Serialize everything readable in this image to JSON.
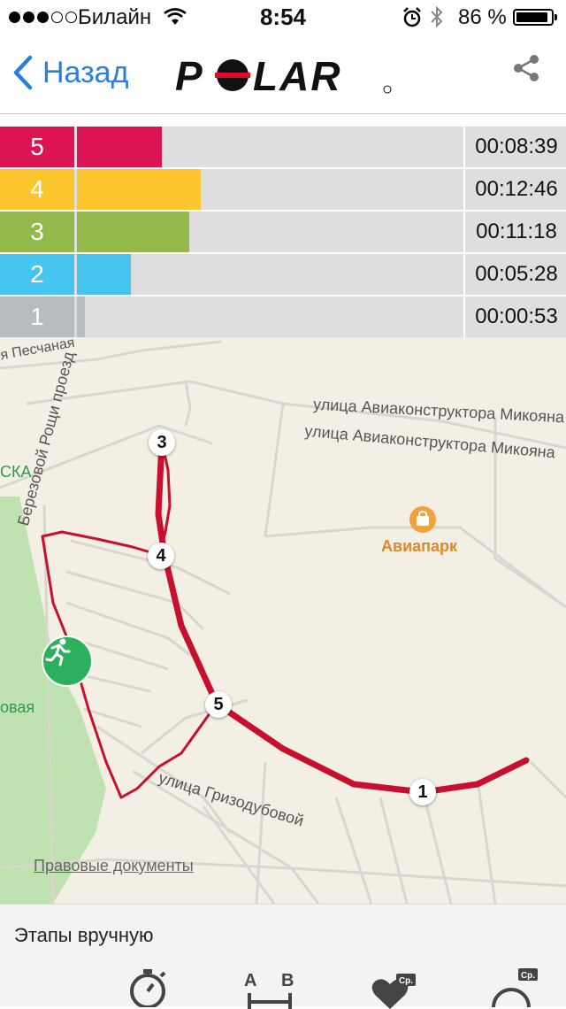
{
  "status_bar": {
    "carrier": "Билайн",
    "time": "8:54",
    "battery": "86 %",
    "signal_bars": 3
  },
  "nav": {
    "back_label": "Назад",
    "logo_text": "POLAR",
    "share_icon": "share-icon"
  },
  "zones": [
    {
      "zone": "5",
      "color": "#dc1453",
      "fraction": 0.22,
      "time": "00:08:39"
    },
    {
      "zone": "4",
      "color": "#fdc62e",
      "fraction": 0.32,
      "time": "00:12:46"
    },
    {
      "zone": "3",
      "color": "#94b94a",
      "fraction": 0.29,
      "time": "00:11:18"
    },
    {
      "zone": "2",
      "color": "#46c6ee",
      "fraction": 0.14,
      "time": "00:05:28"
    },
    {
      "zone": "1",
      "color": "#b7bcbe",
      "fraction": 0.02,
      "time": "00:00:53"
    }
  ],
  "map": {
    "streets": [
      "улица Авиаконструктора Микояна",
      "улица Авиаконструктора Микояна",
      "Березовой Рощи проезд",
      "улица Гризодубовой",
      "я Песчаная"
    ],
    "poi": "Авиапарк",
    "partial_labels": [
      "СКА",
      "овая"
    ],
    "lap_markers": [
      "1",
      "3",
      "4",
      "5"
    ],
    "legal_link": "Правовые документы"
  },
  "bottom": {
    "manual_laps": "Этапы вручную",
    "avg_badge": "Ср."
  }
}
